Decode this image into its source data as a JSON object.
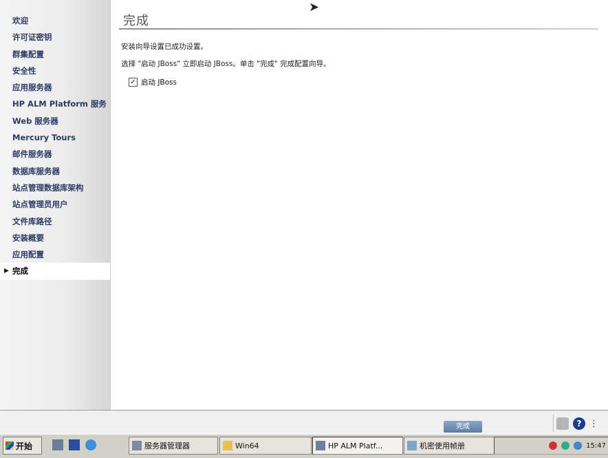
{
  "sidebar": {
    "items": [
      {
        "label": "欢迎"
      },
      {
        "label": "许可证密钥"
      },
      {
        "label": "群集配置"
      },
      {
        "label": "安全性"
      },
      {
        "label": "应用服务器"
      },
      {
        "label": "HP ALM Platform 服务"
      },
      {
        "label": "Web 服务器"
      },
      {
        "label": "Mercury Tours"
      },
      {
        "label": "邮件服务器"
      },
      {
        "label": "数据库服务器"
      },
      {
        "label": "站点管理数据库架构"
      },
      {
        "label": "站点管理员用户"
      },
      {
        "label": "文件库路径"
      },
      {
        "label": "安装概要"
      },
      {
        "label": "应用配置"
      },
      {
        "label": "完成"
      }
    ]
  },
  "main": {
    "title": "完成",
    "line1": "安装向导设置已成功设置。",
    "line2": "选择 \"启动 JBoss\" 立即启动 JBoss。单击 \"完成\" 完成配置向导。",
    "checkbox": {
      "label": "启动 JBoss",
      "checked": true,
      "mark": "✓"
    }
  },
  "footer": {
    "finish_label": "完成",
    "help_icon_text": "?"
  },
  "taskbar": {
    "start_label": "开始",
    "tasks": [
      {
        "label": "服务器管理器"
      },
      {
        "label": "Win64"
      },
      {
        "label": "HP ALM Platf..."
      },
      {
        "label": "机密使用帧册"
      }
    ],
    "clock": "15:47"
  }
}
